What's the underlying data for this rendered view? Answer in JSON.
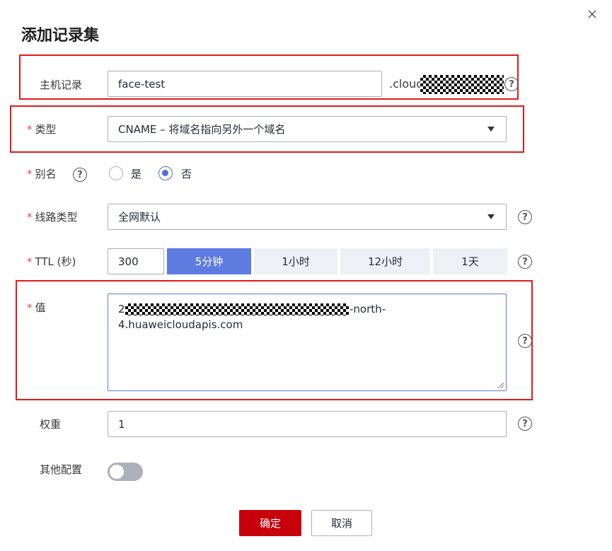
{
  "dialog": {
    "title": "添加记录集",
    "close_icon": "close-icon"
  },
  "host_record": {
    "label": "主机记录",
    "value": "face-test",
    "domain_suffix": ".cloud"
  },
  "type": {
    "label": "类型",
    "value": "CNAME – 将域名指向另外一个域名"
  },
  "alias": {
    "label": "别名",
    "options": [
      "是",
      "否"
    ],
    "selected": "否"
  },
  "line_type": {
    "label": "线路类型",
    "value": "全网默认"
  },
  "ttl": {
    "label": "TTL (秒)",
    "value": "300",
    "presets": [
      "5分钟",
      "1小时",
      "12小时",
      "1天"
    ],
    "active_preset": "5分钟"
  },
  "record_value": {
    "label": "值",
    "line1_prefix": "2",
    "line1_suffix": "-north-",
    "line2": "4.huaweicloudapis.com"
  },
  "weight": {
    "label": "权重",
    "value": "1"
  },
  "other_config": {
    "label": "其他配置",
    "enabled": false
  },
  "actions": {
    "confirm": "确定",
    "cancel": "取消"
  },
  "required_mark": "*",
  "help_glyph": "?",
  "colors": {
    "primary": "#c7000b",
    "accent": "#5e7ce0",
    "highlight_box": "#e01a1a",
    "required": "#e5483e"
  }
}
